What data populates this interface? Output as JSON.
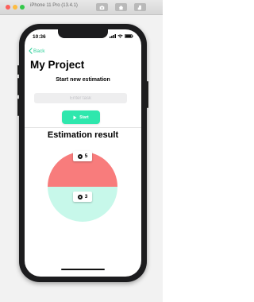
{
  "simulator": {
    "title": "iPhone 11 Pro (13.4.1)"
  },
  "status_bar": {
    "time": "10:36"
  },
  "nav": {
    "back_label": "Back"
  },
  "page": {
    "title": "My Project",
    "subheading": "Start new estimation"
  },
  "task_input": {
    "placeholder": "Enter task",
    "value": ""
  },
  "start_button": {
    "label": "Start"
  },
  "result": {
    "heading": "Estimation result",
    "top_score": "5",
    "bottom_score": "3",
    "top_color": "#f87c7c",
    "bottom_color": "#c7f8ea"
  },
  "colors": {
    "accent": "#2fcf9a",
    "button": "#2ee7ad"
  },
  "icons": [
    "camera-icon",
    "home-icon",
    "rotate-icon",
    "signal-icon",
    "wifi-icon",
    "battery-icon",
    "chevron-left-icon",
    "play-icon",
    "dot-icon"
  ]
}
